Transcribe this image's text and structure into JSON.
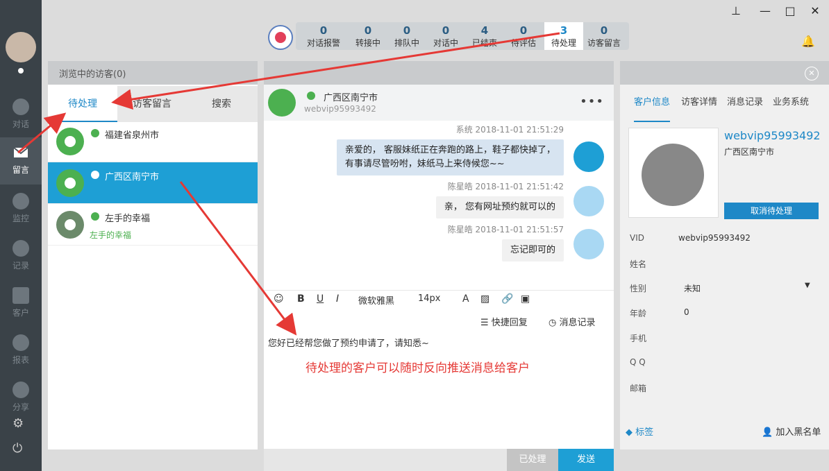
{
  "window": {
    "pin": "⊥",
    "minimize": "—",
    "maximize": "□",
    "close": "✕"
  },
  "leftnav": [
    {
      "label": "对话",
      "icon": "chat-icon"
    },
    {
      "label": "留言",
      "icon": "mail-icon",
      "active": true
    },
    {
      "label": "监控",
      "icon": "eye-icon"
    },
    {
      "label": "记录",
      "icon": "clock-icon"
    },
    {
      "label": "客户",
      "icon": "contact-icon"
    },
    {
      "label": "报表",
      "icon": "pie-icon"
    },
    {
      "label": "分享",
      "icon": "share-icon"
    }
  ],
  "stats": [
    {
      "num": "0",
      "label": "对话报警"
    },
    {
      "num": "0",
      "label": "转接中"
    },
    {
      "num": "0",
      "label": "排队中"
    },
    {
      "num": "0",
      "label": "对话中"
    },
    {
      "num": "4",
      "label": "已结束"
    },
    {
      "num": "0",
      "label": "待评估"
    },
    {
      "num": "3",
      "label": "待处理",
      "active": true
    },
    {
      "num": "0",
      "label": "访客留言"
    }
  ],
  "visitors": {
    "header": "浏览中的访客(0)",
    "tabs": [
      "待处理",
      "访客留言",
      "搜索"
    ],
    "rows": [
      {
        "name": "福建省泉州市",
        "sub": ""
      },
      {
        "name": "广西区南宁市",
        "sub": "",
        "selected": true
      },
      {
        "name": "左手的幸福",
        "sub": "左手的幸福"
      }
    ]
  },
  "chat": {
    "location": "广西区南宁市",
    "vid": "webvip95993492",
    "more": "•••",
    "messages": [
      {
        "sender": "系统",
        "time": "2018-11-01 21:51:29",
        "lines": [
          "亲爱的， 客服妹纸正在奔跑的路上，鞋子都快掉了，",
          "有事请尽管吩咐，妹纸马上来侍候您~~"
        ]
      },
      {
        "sender": "陈星皓",
        "time": "2018-11-01 21:51:42",
        "lines": [
          "亲， 您有网址预约就可以的"
        ]
      },
      {
        "sender": "陈星皓",
        "time": "2018-11-01 21:51:57",
        "lines": [
          "忘记即可的"
        ]
      }
    ],
    "toolbar": {
      "font": "微软雅黑",
      "size": "14px",
      "bold": "B",
      "underline": "U",
      "italic": "I"
    },
    "quick_reply": "快捷回复",
    "history": "消息记录",
    "draft": "您好已经帮您做了预约申请了，请知悉~",
    "btn_done": "已处理",
    "btn_send": "发送"
  },
  "annotation": "待处理的客户可以随时反向推送消息给客户",
  "right": {
    "tabs": [
      "客户信息",
      "访客详情",
      "消息记录",
      "业务系统"
    ],
    "vid_big": "webvip95993492",
    "region": "广西区南宁市",
    "cancel_btn": "取消待处理",
    "fields": [
      {
        "label": "VID",
        "value": "webvip95993492"
      },
      {
        "label": "姓名",
        "value": ""
      },
      {
        "label": "性别",
        "value": "未知"
      },
      {
        "label": "年龄",
        "value": "0"
      },
      {
        "label": "手机",
        "value": ""
      },
      {
        "label": "Q Q",
        "value": ""
      },
      {
        "label": "邮箱",
        "value": ""
      }
    ],
    "tag_label": "标签",
    "blacklist_label": "加入黑名单"
  },
  "colors": {
    "accent": "#1e9fd5",
    "annotation": "#e53935"
  }
}
